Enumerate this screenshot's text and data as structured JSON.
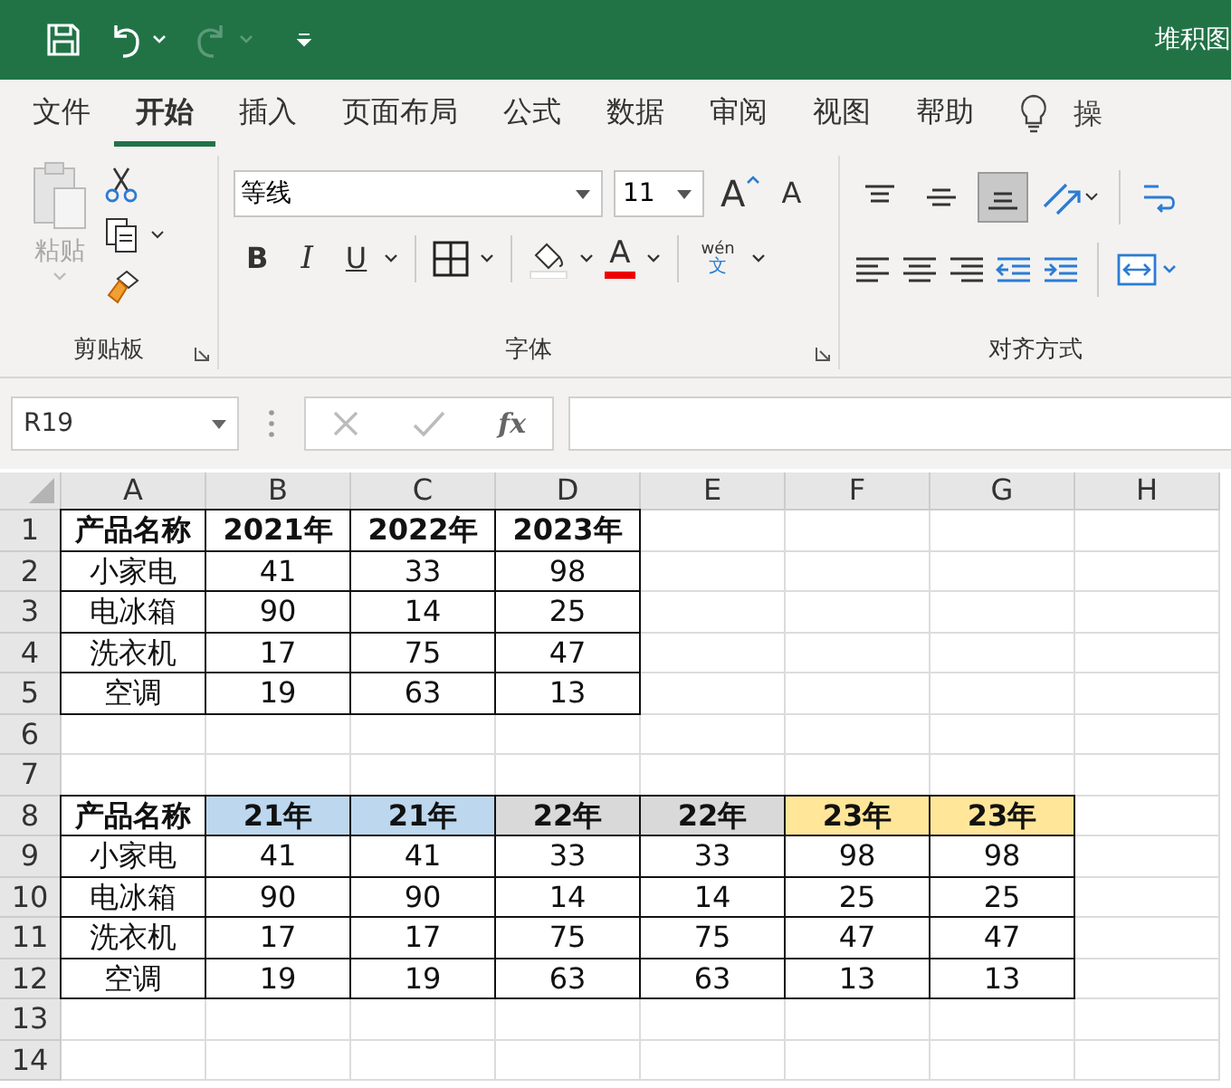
{
  "title_bar": {
    "title": "堆积图",
    "redo_disabled": true
  },
  "menu_tabs": [
    {
      "label": "文件",
      "selected": false
    },
    {
      "label": "开始",
      "selected": true
    },
    {
      "label": "插入",
      "selected": false
    },
    {
      "label": "页面布局",
      "selected": false
    },
    {
      "label": "公式",
      "selected": false
    },
    {
      "label": "数据",
      "selected": false
    },
    {
      "label": "审阅",
      "selected": false
    },
    {
      "label": "视图",
      "selected": false
    },
    {
      "label": "帮助",
      "selected": false
    }
  ],
  "tell_me": "操",
  "ribbon": {
    "clipboard": {
      "paste_label": "粘贴",
      "paste_disabled": true,
      "group_label": "剪贴板"
    },
    "font": {
      "font_name": "等线",
      "font_size": "11",
      "grow_label": "A",
      "shrink_label": "A",
      "bold_label": "B",
      "italic_label": "I",
      "underline_label": "U",
      "font_color_label": "A",
      "phonetic_top": "wén",
      "phonetic_bottom": "文",
      "group_label": "字体"
    },
    "alignment": {
      "vertical": [
        {
          "selected": false
        },
        {
          "selected": false
        },
        {
          "selected": true
        }
      ],
      "group_label": "对齐方式"
    }
  },
  "formula_bar": {
    "name_box": "R19",
    "fx": "fx"
  },
  "sheet": {
    "columns": [
      "A",
      "B",
      "C",
      "D",
      "E",
      "F",
      "G",
      "H"
    ],
    "rows": [
      {
        "number": "1",
        "cells": [
          {
            "text": "产品名称",
            "bold": true,
            "border": true
          },
          {
            "text": "2021年",
            "bold": true,
            "border": true
          },
          {
            "text": "2022年",
            "bold": true,
            "border": true
          },
          {
            "text": "2023年",
            "bold": true,
            "border": true
          }
        ]
      },
      {
        "number": "2",
        "cells": [
          {
            "text": "小家电",
            "bold": false,
            "border": true
          },
          {
            "text": "41",
            "bold": false,
            "border": true
          },
          {
            "text": "33",
            "bold": false,
            "border": true
          },
          {
            "text": "98",
            "bold": false,
            "border": true
          }
        ]
      },
      {
        "number": "3",
        "cells": [
          {
            "text": "电冰箱",
            "bold": false,
            "border": true
          },
          {
            "text": "90",
            "bold": false,
            "border": true
          },
          {
            "text": "14",
            "bold": false,
            "border": true
          },
          {
            "text": "25",
            "bold": false,
            "border": true
          }
        ]
      },
      {
        "number": "4",
        "cells": [
          {
            "text": "洗衣机",
            "bold": false,
            "border": true
          },
          {
            "text": "17",
            "bold": false,
            "border": true
          },
          {
            "text": "75",
            "bold": false,
            "border": true
          },
          {
            "text": "47",
            "bold": false,
            "border": true
          }
        ]
      },
      {
        "number": "5",
        "cells": [
          {
            "text": "空调",
            "bold": false,
            "border": true
          },
          {
            "text": "19",
            "bold": false,
            "border": true
          },
          {
            "text": "63",
            "bold": false,
            "border": true
          },
          {
            "text": "13",
            "bold": false,
            "border": true
          }
        ]
      },
      {
        "number": "6"
      },
      {
        "number": "7"
      },
      {
        "number": "8",
        "cells": [
          {
            "text": "产品名称",
            "bold": true,
            "border": true
          },
          {
            "text": "21年",
            "bold": true,
            "border": true,
            "color": "#bdd7ee"
          },
          {
            "text": "21年",
            "bold": true,
            "border": true,
            "color": "#bdd7ee"
          },
          {
            "text": "22年",
            "bold": true,
            "border": true,
            "color": "#d9d9d9"
          },
          {
            "text": "22年",
            "bold": true,
            "border": true,
            "color": "#d9d9d9"
          },
          {
            "text": "23年",
            "bold": true,
            "border": true,
            "color": "#ffe699"
          },
          {
            "text": "23年",
            "bold": true,
            "border": true,
            "color": "#ffe699"
          }
        ]
      },
      {
        "number": "9",
        "cells": [
          {
            "text": "小家电",
            "bold": false,
            "border": true
          },
          {
            "text": "41",
            "bold": false,
            "border": true
          },
          {
            "text": "41",
            "bold": false,
            "border": true
          },
          {
            "text": "33",
            "bold": false,
            "border": true
          },
          {
            "text": "33",
            "bold": false,
            "border": true
          },
          {
            "text": "98",
            "bold": false,
            "border": true
          },
          {
            "text": "98",
            "bold": false,
            "border": true
          }
        ]
      },
      {
        "number": "10",
        "cells": [
          {
            "text": "电冰箱",
            "bold": false,
            "border": true
          },
          {
            "text": "90",
            "bold": false,
            "border": true
          },
          {
            "text": "90",
            "bold": false,
            "border": true
          },
          {
            "text": "14",
            "bold": false,
            "border": true
          },
          {
            "text": "14",
            "bold": false,
            "border": true
          },
          {
            "text": "25",
            "bold": false,
            "border": true
          },
          {
            "text": "25",
            "bold": false,
            "border": true
          }
        ]
      },
      {
        "number": "11",
        "cells": [
          {
            "text": "洗衣机",
            "bold": false,
            "border": true
          },
          {
            "text": "17",
            "bold": false,
            "border": true
          },
          {
            "text": "17",
            "bold": false,
            "border": true
          },
          {
            "text": "75",
            "bold": false,
            "border": true
          },
          {
            "text": "75",
            "bold": false,
            "border": true
          },
          {
            "text": "47",
            "bold": false,
            "border": true
          },
          {
            "text": "47",
            "bold": false,
            "border": true
          }
        ]
      },
      {
        "number": "12",
        "cells": [
          {
            "text": "空调",
            "bold": false,
            "border": true
          },
          {
            "text": "19",
            "bold": false,
            "border": true
          },
          {
            "text": "19",
            "bold": false,
            "border": true
          },
          {
            "text": "63",
            "bold": false,
            "border": true
          },
          {
            "text": "63",
            "bold": false,
            "border": true
          },
          {
            "text": "13",
            "bold": false,
            "border": true
          },
          {
            "text": "13",
            "bold": false,
            "border": true
          }
        ]
      },
      {
        "number": "13"
      },
      {
        "number": "14"
      }
    ]
  }
}
